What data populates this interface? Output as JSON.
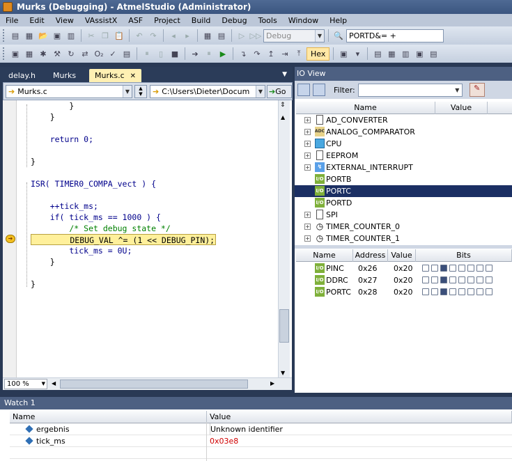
{
  "window": {
    "title": "Murks (Debugging) - AtmelStudio (Administrator)"
  },
  "menu": [
    "File",
    "Edit",
    "View",
    "VAssistX",
    "ASF",
    "Project",
    "Build",
    "Debug",
    "Tools",
    "Window",
    "Help"
  ],
  "toolbar": {
    "config_value": "Debug",
    "find_value": "PORTD&= +",
    "hex_label": "Hex"
  },
  "tabs": [
    {
      "label": "delay.h"
    },
    {
      "label": "Murks"
    },
    {
      "label": "Murks.c",
      "close": "✕"
    }
  ],
  "editor": {
    "file_combo": "Murks.c",
    "path_combo": "C:\\Users\\Dieter\\Docum",
    "go_label": "Go",
    "zoom": "100 %",
    "lines": [
      "        }",
      "    }",
      "",
      "    return 0;",
      "",
      "}",
      "",
      "ISR( TIMER0_COMPA_vect ) {",
      "",
      "    ++tick_ms;",
      "    if( tick_ms == 1000 ) {",
      "        /* Set debug state */",
      "        DEBUG_VAL ^= (1 << DEBUG_PIN);",
      "        tick_ms = 0U;",
      "    }",
      "",
      "}"
    ]
  },
  "ioview": {
    "title": "IO View",
    "filter_label": "Filter:",
    "filter_value": "",
    "col_name": "Name",
    "col_value": "Value",
    "tree": [
      {
        "label": "AD_CONVERTER",
        "icon": "doc-icon",
        "expand": "+"
      },
      {
        "label": "ANALOG_COMPARATOR",
        "icon": "adc-icon",
        "expand": "+"
      },
      {
        "label": "CPU",
        "icon": "cpu-icon",
        "expand": "+"
      },
      {
        "label": "EEPROM",
        "icon": "doc-icon",
        "expand": "+"
      },
      {
        "label": "EXTERNAL_INTERRUPT",
        "icon": "interrupt-icon",
        "expand": "+"
      },
      {
        "label": "PORTB",
        "icon": "io-icon",
        "expand": ""
      },
      {
        "label": "PORTC",
        "icon": "io-icon",
        "expand": "",
        "selected": true
      },
      {
        "label": "PORTD",
        "icon": "io-icon",
        "expand": ""
      },
      {
        "label": "SPI",
        "icon": "doc-icon",
        "expand": "+"
      },
      {
        "label": "TIMER_COUNTER_0",
        "icon": "clock-icon",
        "expand": "+"
      },
      {
        "label": "TIMER_COUNTER_1",
        "icon": "clock-icon",
        "expand": "+"
      }
    ],
    "io_icon_text": "I/O",
    "reg_headers": {
      "name": "Name",
      "address": "Address",
      "value": "Value",
      "bits": "Bits"
    },
    "registers": [
      {
        "name": "PINC",
        "address": "0x26",
        "value": "0x20",
        "bits": [
          0,
          0,
          1,
          0,
          0,
          0,
          0,
          0
        ]
      },
      {
        "name": "DDRC",
        "address": "0x27",
        "value": "0x20",
        "bits": [
          0,
          0,
          1,
          0,
          0,
          0,
          0,
          0
        ]
      },
      {
        "name": "PORTC",
        "address": "0x28",
        "value": "0x20",
        "bits": [
          0,
          0,
          1,
          0,
          0,
          0,
          0,
          0
        ]
      }
    ]
  },
  "watch": {
    "title": "Watch 1",
    "col_name": "Name",
    "col_value": "Value",
    "rows": [
      {
        "name": "ergebnis",
        "value": "Unknown identifier",
        "changed": false
      },
      {
        "name": "tick_ms",
        "value": "0x03e8",
        "changed": true
      }
    ]
  },
  "colors": {
    "accent": "#1b2f63",
    "current_line": "#fff09b",
    "changed_value": "#d00000"
  }
}
